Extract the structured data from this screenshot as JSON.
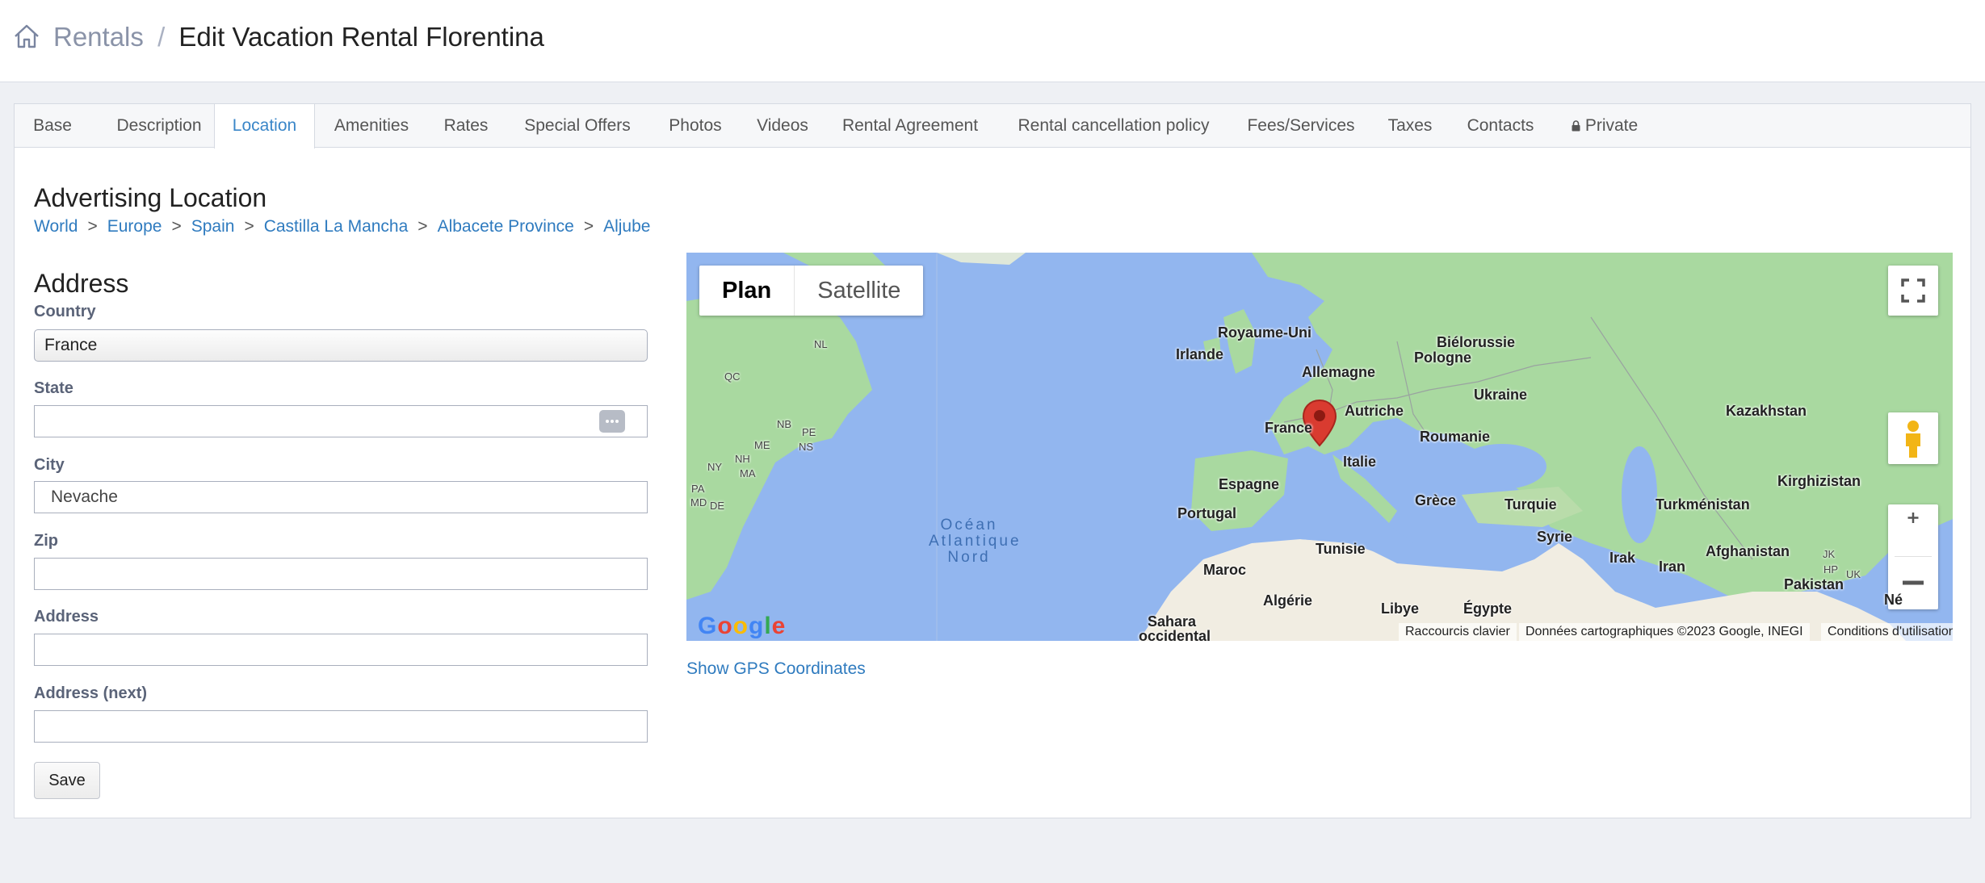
{
  "breadcrumb": {
    "parent": "Rentals",
    "separator": "/",
    "current": "Edit Vacation Rental Florentina",
    "home_icon": "home-icon"
  },
  "tabs": [
    {
      "label": "Base"
    },
    {
      "label": "Description"
    },
    {
      "label": "Location",
      "active": true
    },
    {
      "label": "Amenities"
    },
    {
      "label": "Rates"
    },
    {
      "label": "Special Offers"
    },
    {
      "label": "Photos"
    },
    {
      "label": "Videos"
    },
    {
      "label": "Rental Agreement"
    },
    {
      "label": "Rental cancellation policy"
    },
    {
      "label": "Fees/Services"
    },
    {
      "label": "Taxes"
    },
    {
      "label": "Contacts"
    },
    {
      "label": "Private",
      "icon": "lock-icon"
    }
  ],
  "advertising": {
    "title": "Advertising Location",
    "path": [
      "World",
      "Europe",
      "Spain",
      "Castilla La Mancha",
      "Albacete Province",
      "Aljube"
    ],
    "separator": ">"
  },
  "address": {
    "title": "Address",
    "country": {
      "label": "Country",
      "value": "France"
    },
    "state": {
      "label": "State",
      "value": ""
    },
    "city": {
      "label": "City",
      "value": "Nevache"
    },
    "zip": {
      "label": "Zip",
      "value": ""
    },
    "address": {
      "label": "Address",
      "value": ""
    },
    "address_next": {
      "label": "Address (next)",
      "value": ""
    },
    "save_label": "Save"
  },
  "map": {
    "type_plan": "Plan",
    "type_satellite": "Satellite",
    "labels": {
      "royaume_uni": "Royaume-Uni",
      "irlande": "Irlande",
      "bielorussie": "Biélorussie",
      "allemagne": "Allemagne",
      "pologne": "Pologne",
      "ukraine": "Ukraine",
      "kazakhstan": "Kazakhstan",
      "france": "France",
      "autriche": "Autriche",
      "roumanie": "Roumanie",
      "italie": "Italie",
      "espagne": "Espagne",
      "kirghizistan": "Kirghizistan",
      "portugal": "Portugal",
      "grece": "Grèce",
      "turquie": "Turquie",
      "turkmenistan": "Turkménistan",
      "tunisie": "Tunisie",
      "syrie": "Syrie",
      "irak": "Irak",
      "iran": "Iran",
      "afghanistan": "Afghanistan",
      "maroc": "Maroc",
      "pakistan": "Pakistan",
      "algerie": "Algérie",
      "libye": "Libye",
      "egypte": "Égypte",
      "sahara": "Sahara",
      "occidental": "occidental",
      "ne": "Né",
      "nl": "NL",
      "qc": "QC",
      "nb": "NB",
      "pe": "PE",
      "me": "ME",
      "ns": "NS",
      "nh": "NH",
      "ny": "NY",
      "ma": "MA",
      "pa": "PA",
      "md": "MD",
      "de": "DE",
      "jk": "JK",
      "hp": "HP",
      "uk": "UK"
    },
    "ocean": [
      "Océan",
      "Atlantique",
      "Nord"
    ],
    "google": "Google",
    "attrib_shortcuts": "Raccourcis clavier",
    "attrib_data": "Données cartographiques ©2023 Google, INEGI",
    "attrib_terms": "Conditions d'utilisation",
    "colors": {
      "water": "#92b6ef",
      "land": "#a9d9a0",
      "desert": "#f1ede2",
      "pin": "#d93b30"
    }
  },
  "gps_link": "Show GPS Coordinates"
}
